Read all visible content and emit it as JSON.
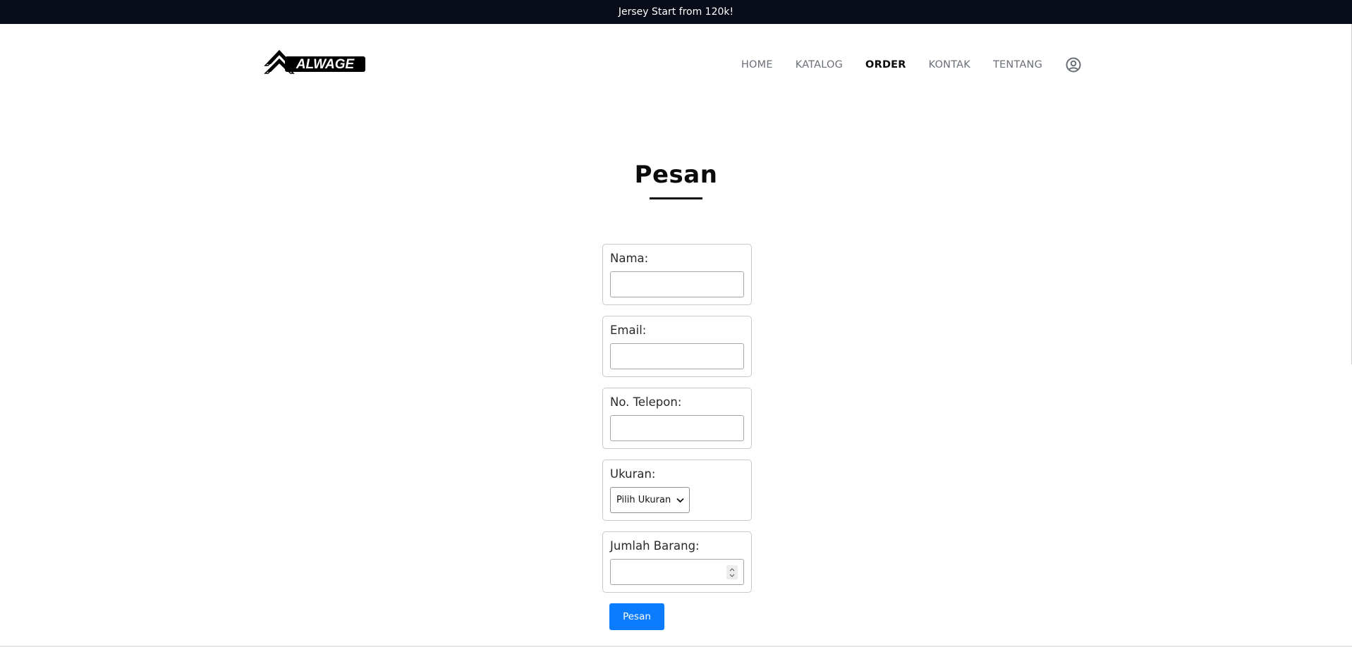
{
  "announcement": "Jersey Start from 120k!",
  "brand": {
    "logo_text": "ALWAGE"
  },
  "nav": {
    "items": [
      {
        "label": "HOME",
        "active": false
      },
      {
        "label": "KATALOG",
        "active": false
      },
      {
        "label": "ORDER",
        "active": true
      },
      {
        "label": "KONTAK",
        "active": false
      },
      {
        "label": "TENTANG",
        "active": false
      }
    ],
    "user_icon": "user-circle-icon"
  },
  "page": {
    "title": "Pesan"
  },
  "form": {
    "nama_label": "Nama:",
    "nama_value": "",
    "email_label": "Email:",
    "email_value": "",
    "telepon_label": "No. Telepon:",
    "telepon_value": "",
    "ukuran_label": "Ukuran:",
    "ukuran_selected": "Pilih Ukuran",
    "jumlah_label": "Jumlah Barang:",
    "jumlah_value": "",
    "submit_label": "Pesan"
  },
  "colors": {
    "topbar": "#080c18",
    "button": "#0c7cff",
    "nav_inactive": "#6b6f78",
    "nav_active": "#0b0b0b"
  }
}
